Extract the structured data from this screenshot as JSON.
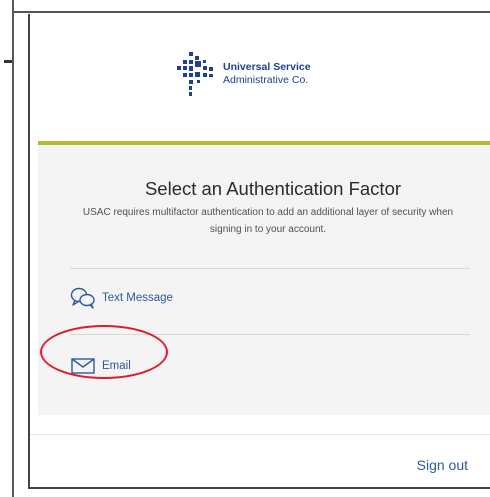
{
  "brand": {
    "line1": "Universal Service",
    "line2": "Administrative Co.",
    "color": "#1f3f8f",
    "accent": "#b5bb35"
  },
  "auth": {
    "title": "Select an Authentication Factor",
    "subtitle": "USAC requires multifactor authentication to add an additional layer of security when signing in to your account.",
    "factors": [
      {
        "label": "Text Message",
        "icon": "chat-bubbles-icon"
      },
      {
        "label": "Email",
        "icon": "envelope-icon"
      }
    ]
  },
  "footer": {
    "sign_out": "Sign out"
  },
  "annotation": {
    "highlight_color": "#e01b2d",
    "highlight_target": "Email"
  }
}
